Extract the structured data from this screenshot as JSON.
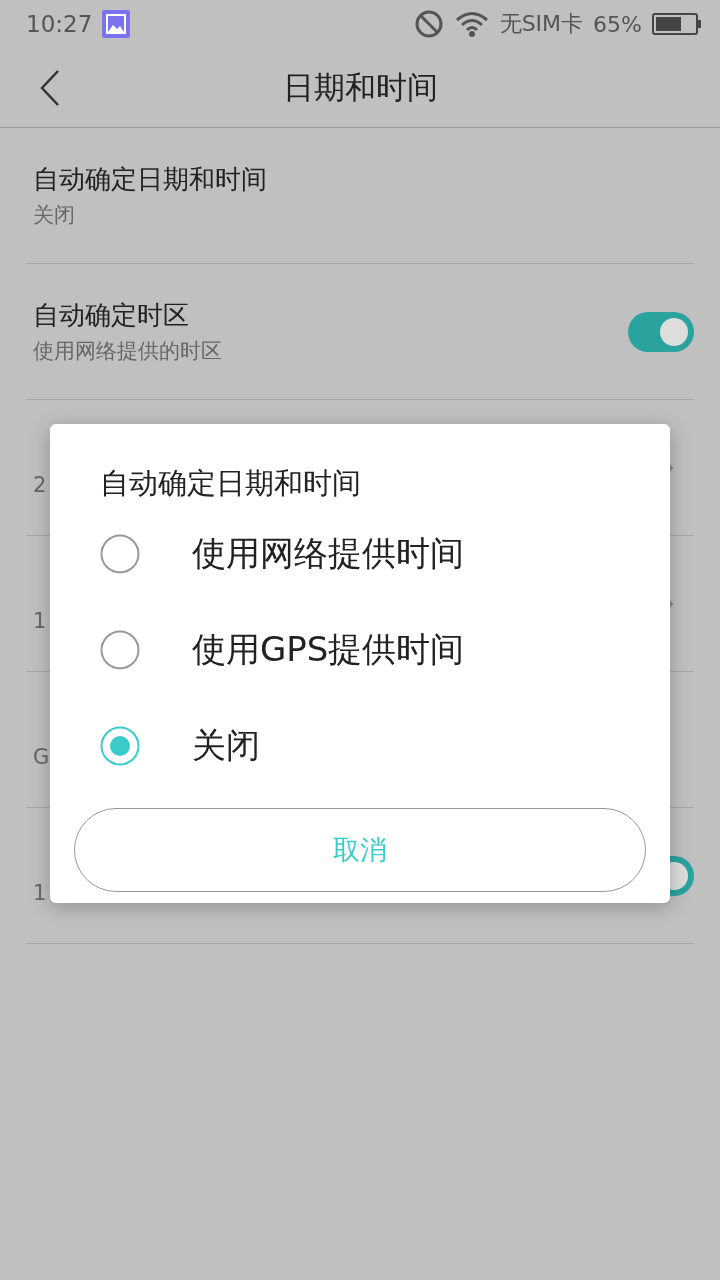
{
  "status_bar": {
    "time": "10:27",
    "carrier": "无SIM卡",
    "battery": "65%"
  },
  "toolbar": {
    "title": "日期和时间"
  },
  "settings": [
    {
      "kind": "plain",
      "title": "自动确定日期和时间",
      "subtitle": "关闭"
    },
    {
      "kind": "switch",
      "title": "自动确定时区",
      "subtitle": "使用网络提供的时区",
      "on": true
    },
    {
      "kind": "chevron",
      "subtitle": "2"
    },
    {
      "kind": "chevron",
      "subtitle": "1"
    },
    {
      "kind": "plain",
      "subtitle": "G"
    },
    {
      "kind": "switch",
      "subtitle": "1",
      "on": true
    }
  ],
  "dialog": {
    "title": "自动确定日期和时间",
    "options": [
      {
        "label": "使用网络提供时间",
        "selected": false
      },
      {
        "label": "使用GPS提供时间",
        "selected": false
      },
      {
        "label": "关闭",
        "selected": true
      }
    ],
    "cancel": "取消"
  }
}
